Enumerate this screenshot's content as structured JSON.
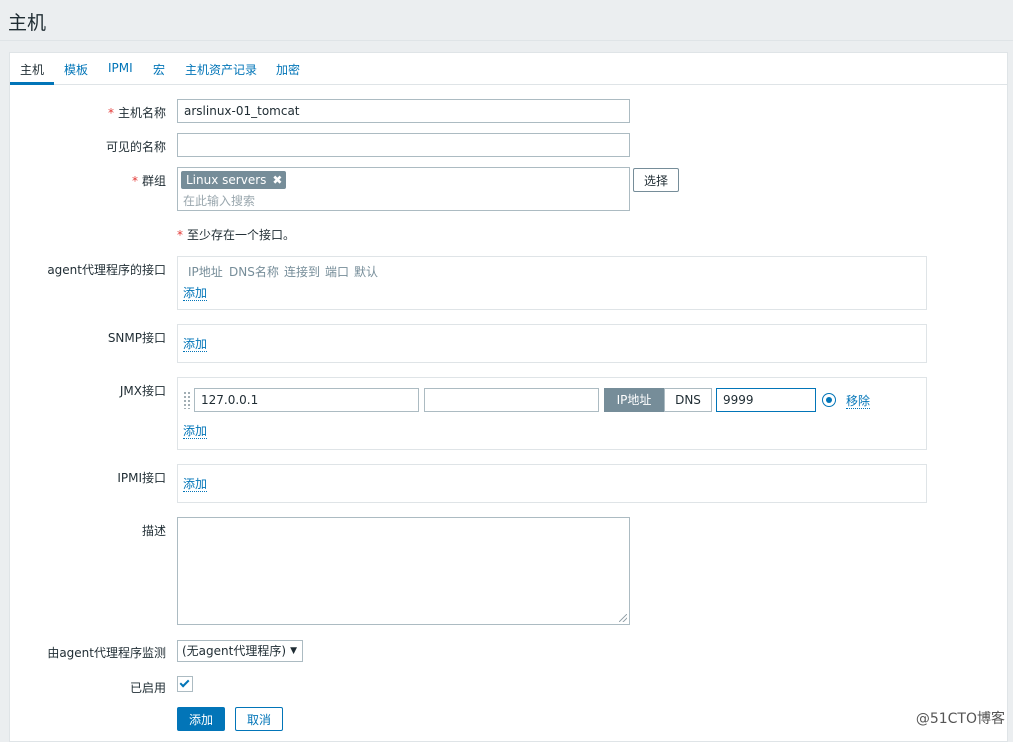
{
  "page": {
    "title": "主机"
  },
  "tabs": [
    {
      "label": "主机"
    },
    {
      "label": "模板"
    },
    {
      "label": "IPMI"
    },
    {
      "label": "宏"
    },
    {
      "label": "主机资产记录"
    },
    {
      "label": "加密"
    }
  ],
  "form": {
    "host_name": {
      "label": "主机名称",
      "value": "arslinux-01_tomcat"
    },
    "visible_name": {
      "label": "可见的名称",
      "value": ""
    },
    "groups": {
      "label": "群组",
      "selected": "Linux servers",
      "placeholder": "在此输入搜索",
      "select_button": "选择"
    },
    "interface_note": "至少存在一个接口。",
    "agent_interfaces": {
      "label": "agent代理程序的接口",
      "columns": [
        "IP地址",
        "DNS名称",
        "连接到",
        "端口",
        "默认"
      ],
      "add_link": "添加"
    },
    "snmp_interfaces": {
      "label": "SNMP接口",
      "add_link": "添加"
    },
    "jmx_interfaces": {
      "label": "JMX接口",
      "ip": "127.0.0.1",
      "dns": "",
      "connect_ip": "IP地址",
      "connect_dns": "DNS",
      "port": "9999",
      "remove_link": "移除",
      "add_link": "添加"
    },
    "ipmi_interfaces": {
      "label": "IPMI接口",
      "add_link": "添加"
    },
    "description": {
      "label": "描述",
      "value": ""
    },
    "proxy": {
      "label": "由agent代理程序监测",
      "selected": "(无agent代理程序)"
    },
    "enabled": {
      "label": "已启用",
      "checked": true
    },
    "buttons": {
      "add": "添加",
      "cancel": "取消"
    }
  },
  "watermark": "@51CTO博客",
  "colors": {
    "accent": "#0275b8",
    "required": "#e33734",
    "chip": "#768d99"
  }
}
